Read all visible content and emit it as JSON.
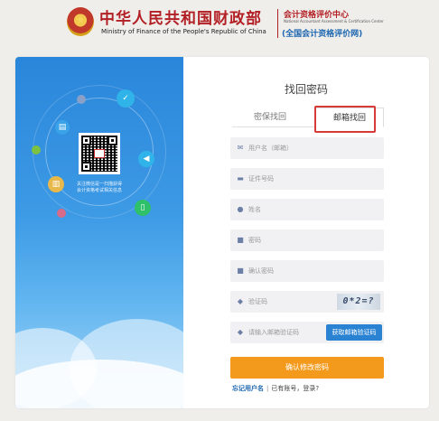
{
  "header": {
    "title_cn": "中华人民共和国财政部",
    "title_en": "Ministry of Finance of the People's Republic of China",
    "org_cn": "会计资格评价中心",
    "org_en": "National Accountant Assessment & Certification Center",
    "org_sub": "(全国会计资格评价网)"
  },
  "left_panel": {
    "qr_caption_line1": "关注微信是一扫描获得",
    "qr_caption_line2": "会计资格考试相关信息"
  },
  "form": {
    "title": "找回密码",
    "tabs": [
      {
        "label": "密保找回"
      },
      {
        "label": "邮箱找回"
      }
    ],
    "fields": {
      "username": "用户名（邮箱）",
      "id_number": "证件号码",
      "name": "姓名",
      "password": "密码",
      "confirm_password": "确认密码",
      "verify_code": "验证码",
      "email_code": "请输入邮箱验证码"
    },
    "captcha_text": "0*2=?",
    "get_code_label": "获取邮箱验证码",
    "submit_label": "确认修改密码",
    "forgot_username": "忘记用户名",
    "has_account": "已有账号，登录?"
  },
  "colors": {
    "brand_red": "#b21f24",
    "panel_blue": "#2a86da",
    "submit_orange": "#f39a1c",
    "highlight_red": "#d83a3a"
  }
}
